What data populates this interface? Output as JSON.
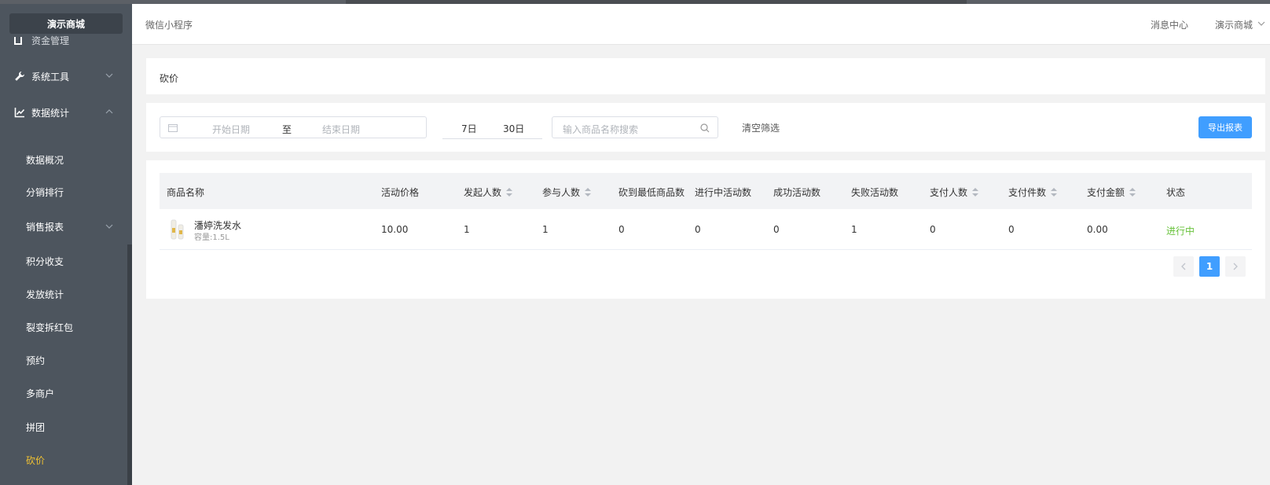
{
  "brand": "演示商城",
  "sidebar": {
    "cut_item": "资金管理",
    "groups": [
      {
        "label": "系统工具",
        "icon": "wrench-icon",
        "expanded": false
      },
      {
        "label": "数据统计",
        "icon": "line-chart-icon",
        "expanded": true
      }
    ],
    "items": [
      {
        "label": "数据概况"
      },
      {
        "label": "分销排行"
      },
      {
        "label": "销售报表",
        "has_children": true
      },
      {
        "label": "积分收支"
      },
      {
        "label": "发放统计"
      },
      {
        "label": "裂变拆红包"
      },
      {
        "label": "预约"
      },
      {
        "label": "多商户"
      },
      {
        "label": "拼团"
      },
      {
        "label": "砍价",
        "active": true
      }
    ]
  },
  "header": {
    "title": "微信小程序",
    "message_center": "消息中心",
    "user": "演示商城"
  },
  "breadcrumb": "砍价",
  "filters": {
    "start_placeholder": "开始日期",
    "range_separator": "至",
    "end_placeholder": "结束日期",
    "quick_7": "7日",
    "quick_30": "30日",
    "search_placeholder": "输入商品名称搜索",
    "clear": "清空筛选",
    "export": "导出报表"
  },
  "table": {
    "columns": [
      {
        "label": "商品名称",
        "sortable": false
      },
      {
        "label": "活动价格",
        "sortable": false
      },
      {
        "label": "发起人数",
        "sortable": true
      },
      {
        "label": "参与人数",
        "sortable": true
      },
      {
        "label": "砍到最低商品数",
        "sortable": false
      },
      {
        "label": "进行中活动数",
        "sortable": false
      },
      {
        "label": "成功活动数",
        "sortable": false
      },
      {
        "label": "失败活动数",
        "sortable": false
      },
      {
        "label": "支付人数",
        "sortable": true
      },
      {
        "label": "支付件数",
        "sortable": true
      },
      {
        "label": "支付金额",
        "sortable": true
      },
      {
        "label": "状态",
        "sortable": false
      }
    ],
    "rows": [
      {
        "name": "潘婷洗发水",
        "spec": "容量:1.5L",
        "price": "10.00",
        "initiators": "1",
        "participants": "1",
        "lowest": "0",
        "ongoing": "0",
        "success": "0",
        "failed": "1",
        "payers": "0",
        "paid_items": "0",
        "paid_amount": "0.00",
        "status": "进行中"
      }
    ]
  },
  "pagination": {
    "current": "1"
  },
  "colors": {
    "primary": "#409eff",
    "success": "#67c23a",
    "sidebar": "#4d555e",
    "active_menu": "#f1c232"
  }
}
